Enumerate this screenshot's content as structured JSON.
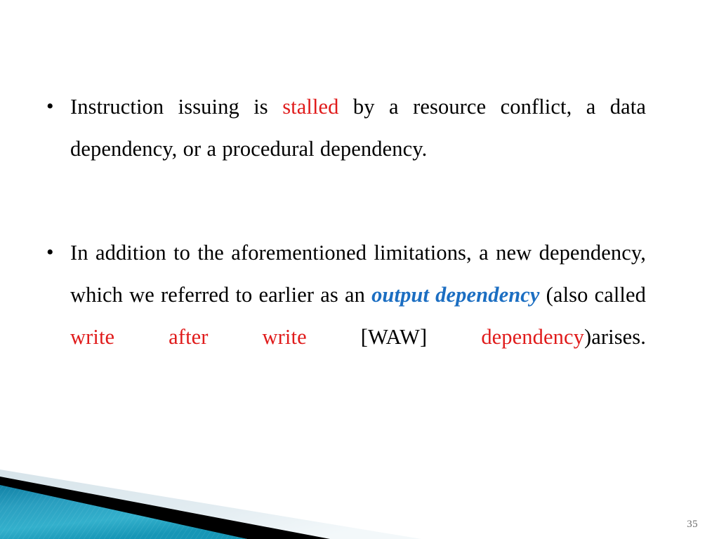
{
  "slide": {
    "background_color": "#ffffff",
    "slide_number": "35",
    "accent_colors": {
      "red": "#e01b1b",
      "blue": "#1b6ec2",
      "teal_light": "#35aecb",
      "teal_dark": "#0f7f9e",
      "black": "#000000",
      "pale_blue": "#dfe9ee",
      "slide_number_gray": "#6d6d6d"
    }
  },
  "bullets": [
    {
      "marker": "•",
      "runs": [
        {
          "text": "Instruction issuing is ",
          "style": "normal"
        },
        {
          "text": "stalled",
          "style": "red"
        },
        {
          "text": " by a resource conflict, a data dependency, or a procedural dependency.",
          "style": "normal"
        }
      ]
    },
    {
      "marker": "•",
      "runs": [
        {
          "text": "In addition to the aforementioned limitations, a new dependency, which we referred to earlier as an ",
          "style": "normal"
        },
        {
          "text": "output dependency",
          "style": "blue-bold-italic"
        },
        {
          "text": " (also called ",
          "style": "normal"
        },
        {
          "text": "write after write",
          "style": "red"
        },
        {
          "text": " [WAW] ",
          "style": "normal"
        },
        {
          "text": "dependency",
          "style": "red"
        },
        {
          "text": ")arises.",
          "style": "normal"
        }
      ]
    }
  ],
  "decoration": {
    "name": "bottom-left-corner-banner",
    "shapes": [
      {
        "name": "teal-triangle",
        "fill": "#1d93b4"
      },
      {
        "name": "black-wedge",
        "fill": "#000000"
      },
      {
        "name": "pale-blue-wedge",
        "fill": "#dfe9ee"
      }
    ]
  }
}
